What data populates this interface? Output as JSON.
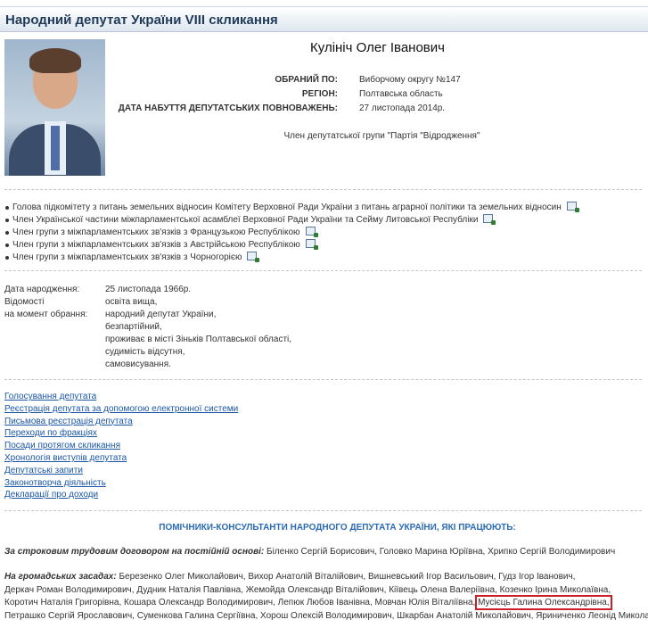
{
  "header": {
    "title": "Народний депутат України VIII скликання"
  },
  "profile": {
    "name": "Кулініч Олег Іванович",
    "elected_by_label": "ОБРАНИЙ ПО:",
    "elected_by_value": "Виборчому округу №147",
    "region_label": "РЕГІОН:",
    "region_value": "Полтавська область",
    "date_label": "ДАТА НАБУТТЯ ДЕПУТАТСЬКИХ ПОВНОВАЖЕНЬ:",
    "date_value": "27 листопада 2014р.",
    "faction": "Член депутатської групи \"Партія \"Відродження\""
  },
  "posts": [
    "Голова підкомітету з питань земельних відносин Комітету Верховної Ради України з питань аграрної політики та земельних відносин",
    "Член Української частини міжпарламентської асамблеї Верховної Ради України та Сейму Литовської Республіки",
    "Член групи з міжпарламентських зв'язків з Французькою Республікою",
    "Член групи з міжпарламентських зв'язків з Австрійською Республікою",
    "Член групи з міжпарламентських зв'язків з Чорногорією"
  ],
  "bio": {
    "birth_label": "Дата народження:",
    "birth_value": "25 листопада 1966р.",
    "info_label_1": "Відомості",
    "info_label_2": "на момент обрання:",
    "info_lines": [
      "освіта вища,",
      "народний депутат України,",
      "безпартійний,",
      "проживає в місті Зіньків Полтавської області,",
      "судимість відсутня,",
      "самовисування."
    ]
  },
  "links": [
    "Голосування депутата",
    "Реєстрація депутата за допомогою електронної системи",
    "Письмова реєстрація депутата",
    "Переходи по фракціях",
    "Посади протягом скликання",
    "Хронологія виступів депутата",
    "Депутатські запити",
    "Законотворча діяльність",
    "Декларації про доходи"
  ],
  "assistants": {
    "title": "ПОМІЧНИКИ-КОНСУЛЬТАНТИ НАРОДНОГО ДЕПУТАТА УКРАЇНИ, ЯКІ ПРАЦЮЮТЬ:",
    "contract_label": "За строковим трудовим договором на постійній основі:",
    "contract_names": "Біленко Сергій Борисович, Головко Марина Юріївна, Хрипко Сергій Володимирович",
    "volunteer_label": "На громадських засадах:",
    "volunteer_line1": "Березенко Олег Миколайович, Вихор Анатолій Віталійович, Вишневський Ігор Васильович, Гудз Ігор Іванович,",
    "volunteer_line2": "Деркач Роман Володимирович, Дудник Наталія Павлівна, Жемойда Олександр Віталійович, Кіївець Олена Валеріївна, Козенко Ірина Миколаївна,",
    "volunteer_line3_a": "Коротич Наталія Григорівна, Кошара Олександр Володимирович, Лепюк Любов Іванівна, Мовчан Юлія Віталіївна,",
    "volunteer_line3_highlight": "Мусієць Галина Олександрівна,",
    "volunteer_line4": "Петрашко Сергій Ярославович, Суменкова Галина Сергіївна, Хорош Олексій Володимирович, Шкарбан Анатолій Миколайович, Яриниченко Леонід Миколайович"
  }
}
